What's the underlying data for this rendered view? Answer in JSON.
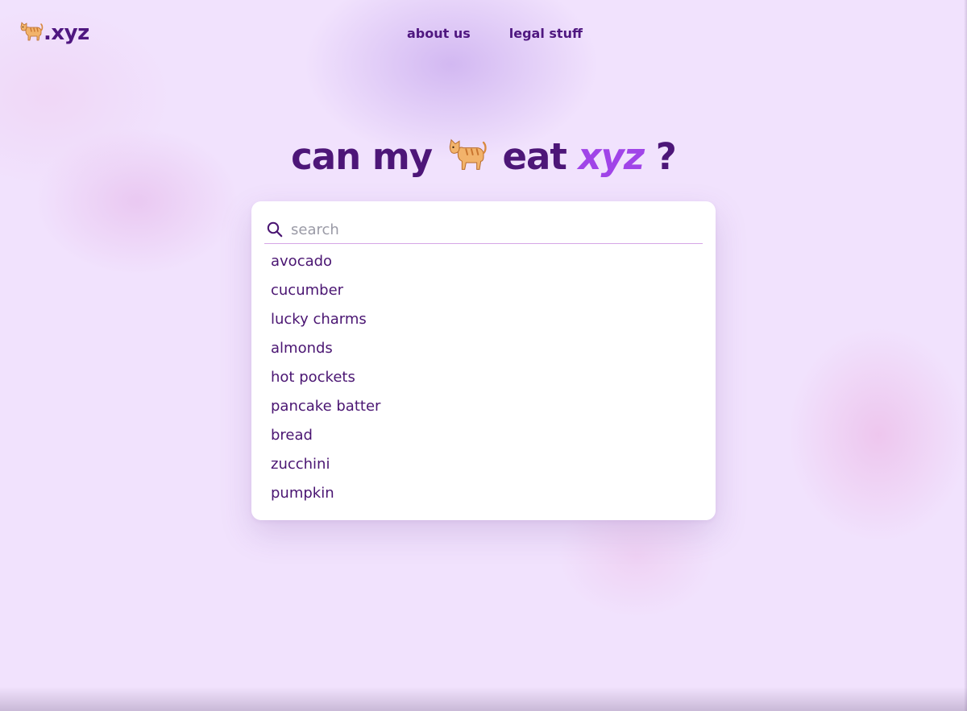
{
  "header": {
    "logo_text": ".xyz",
    "nav": [
      {
        "label": "about us"
      },
      {
        "label": "legal stuff"
      }
    ]
  },
  "hero": {
    "before_icon": "can my",
    "after_icon": "eat",
    "accent": "xyz",
    "end": "?"
  },
  "search": {
    "placeholder": "search",
    "value": ""
  },
  "results": [
    {
      "label": "avocado"
    },
    {
      "label": "cucumber"
    },
    {
      "label": "lucky charms"
    },
    {
      "label": "almonds"
    },
    {
      "label": "hot pockets"
    },
    {
      "label": "pancake batter"
    },
    {
      "label": "bread"
    },
    {
      "label": "zucchini"
    },
    {
      "label": "pumpkin"
    }
  ],
  "icons": {
    "logo_icon": "cat-icon",
    "hero_icon": "cat-icon",
    "search_icon": "search-icon"
  },
  "colors": {
    "background": "#f1e2fd",
    "text": "#4a1572",
    "accent": "#a044e8",
    "card": "#ffffff",
    "search_underline": "#d6a6e6"
  }
}
